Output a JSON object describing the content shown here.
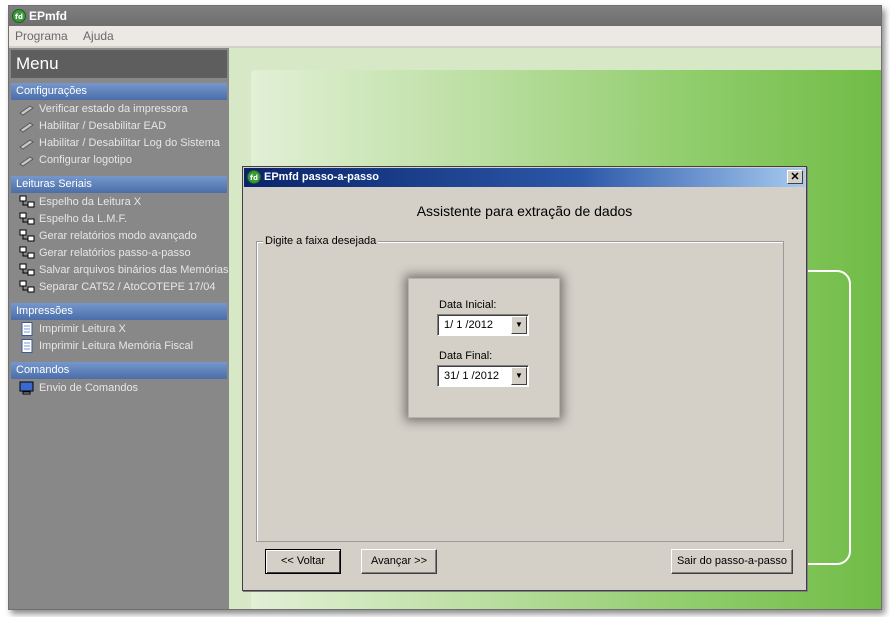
{
  "window": {
    "title": "EPmfd"
  },
  "menubar": {
    "items": [
      "Programa",
      "Ajuda"
    ]
  },
  "sidebar": {
    "header": "Menu",
    "sections": [
      {
        "title": "Configurações",
        "items": [
          "Verificar estado da impressora",
          "Habilitar / Desabilitar EAD",
          "Habilitar / Desabilitar Log do Sistema",
          "Configurar logotipo"
        ]
      },
      {
        "title": "Leituras Seriais",
        "items": [
          "Espelho da Leitura X",
          "Espelho da L.M.F.",
          "Gerar relatórios modo avançado",
          "Gerar relatórios passo-a-passo",
          "Salvar arquivos binários das Memórias",
          "Separar CAT52 / AtoCOTEPE 17/04"
        ]
      },
      {
        "title": "Impressões",
        "items": [
          "Imprimir Leitura X",
          "Imprimir Leitura Memória Fiscal"
        ]
      },
      {
        "title": "Comandos",
        "items": [
          "Envio de Comandos"
        ]
      }
    ]
  },
  "dialog": {
    "title": "EPmfd passo-a-passo",
    "heading": "Assistente para extração de dados",
    "group_label": "Digite a faixa desejada",
    "start_label": "Data Inicial:",
    "start_value": "1/ 1 /2012",
    "end_label": "Data Final:",
    "end_value": "31/ 1 /2012",
    "back_button": "<< Voltar",
    "next_button": "Avançar >>",
    "exit_button": "Sair do passo-a-passo"
  },
  "colors": {
    "section_header": "#4b6ea9",
    "dialog_title": "#0a246a",
    "green_accent": "#6fbb45"
  }
}
